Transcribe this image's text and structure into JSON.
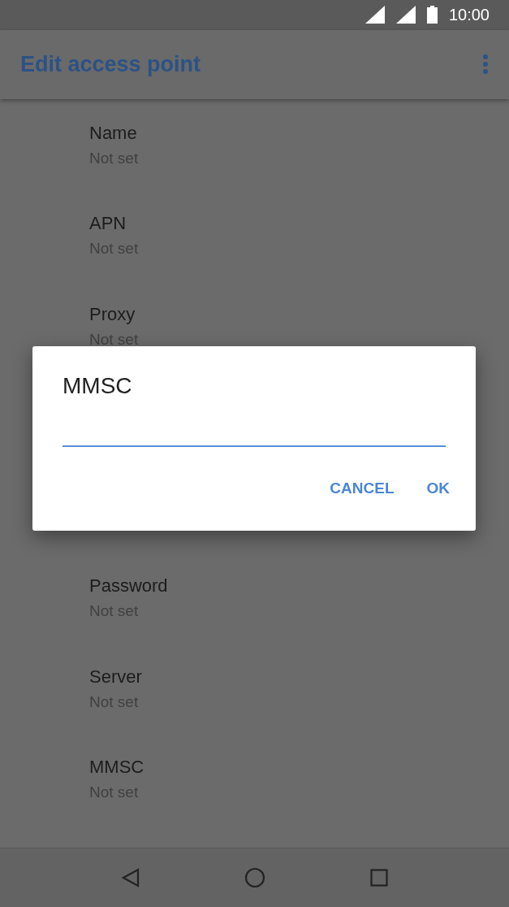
{
  "status_bar": {
    "time": "10:00"
  },
  "app_bar": {
    "title": "Edit access point"
  },
  "settings": [
    {
      "title": "Name",
      "value": "Not set"
    },
    {
      "title": "APN",
      "value": "Not set"
    },
    {
      "title": "Proxy",
      "value": "Not set"
    },
    {
      "kind": "hidden"
    },
    {
      "title": "Password",
      "value": "Not set"
    },
    {
      "title": "Server",
      "value": "Not set"
    },
    {
      "title": "MMSC",
      "value": "Not set"
    }
  ],
  "dialog": {
    "title": "MMSC",
    "buttons": [
      "CANCEL",
      "OK"
    ]
  }
}
